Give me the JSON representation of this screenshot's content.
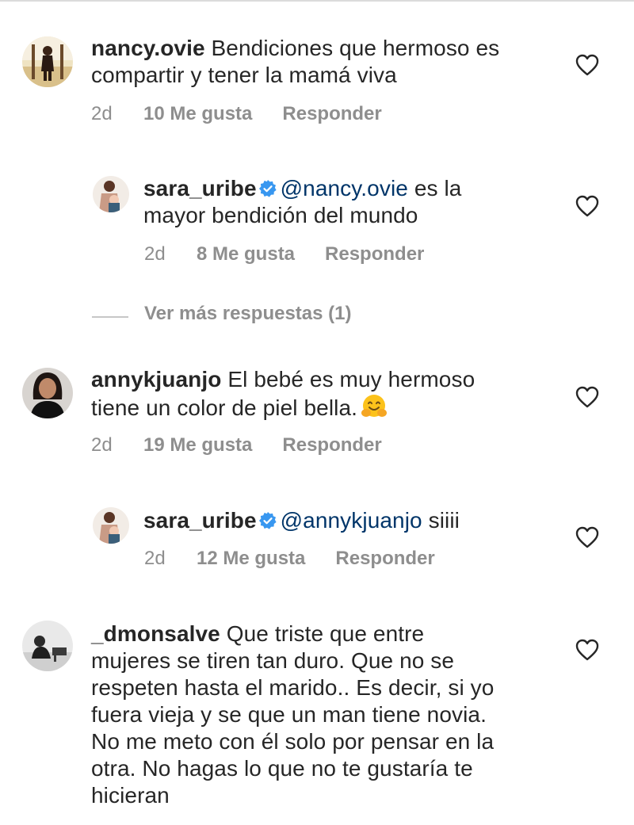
{
  "comments": [
    {
      "username": "nancy.ovie",
      "text_line1": " Bendiciones que hermoso es",
      "text_line2": "compartir y tener la mamá viva",
      "time": "2d",
      "likes": "10 Me gusta",
      "reply": "Responder",
      "avatar_icon": "avatar-woman-beach"
    },
    {
      "username": "sara_uribe",
      "mention": "@nancy.ovie",
      "text_line1_rest": " es la",
      "text_line2": "mayor bendición del mundo",
      "time": "2d",
      "likes": "8 Me gusta",
      "reply": "Responder",
      "verified": true,
      "avatar_icon": "avatar-woman-baby"
    },
    {
      "username": "annykjuanjo",
      "text_line1": " El bebé es muy hermoso",
      "text_line2": "tiene un color de piel bella.",
      "emoji_icon": "hugging-face-emoji",
      "time": "2d",
      "likes": "19 Me gusta",
      "reply": "Responder",
      "avatar_icon": "avatar-woman-portrait"
    },
    {
      "username": "sara_uribe",
      "mention": "@annykjuanjo",
      "text_rest": " siiii",
      "time": "2d",
      "likes": "12 Me gusta",
      "reply": "Responder",
      "verified": true,
      "avatar_icon": "avatar-woman-baby"
    },
    {
      "username": "_dmonsalve",
      "lines": [
        " Que triste que entre",
        "mujeres se tiren tan duro. Que no se",
        "respeten hasta el marido.. Es decir, si yo",
        "fuera vieja y se que un man tiene novia.",
        "No me meto con él solo por pensar en la",
        "otra. No hagas lo que no te gustaría te",
        "hicieran"
      ],
      "avatar_icon": "avatar-man-dark"
    }
  ],
  "more_replies": "Ver más respuestas (1)",
  "colors": {
    "text": "#262626",
    "meta": "#8e8e8e",
    "mention": "#003569",
    "verified": "#3897f0"
  }
}
